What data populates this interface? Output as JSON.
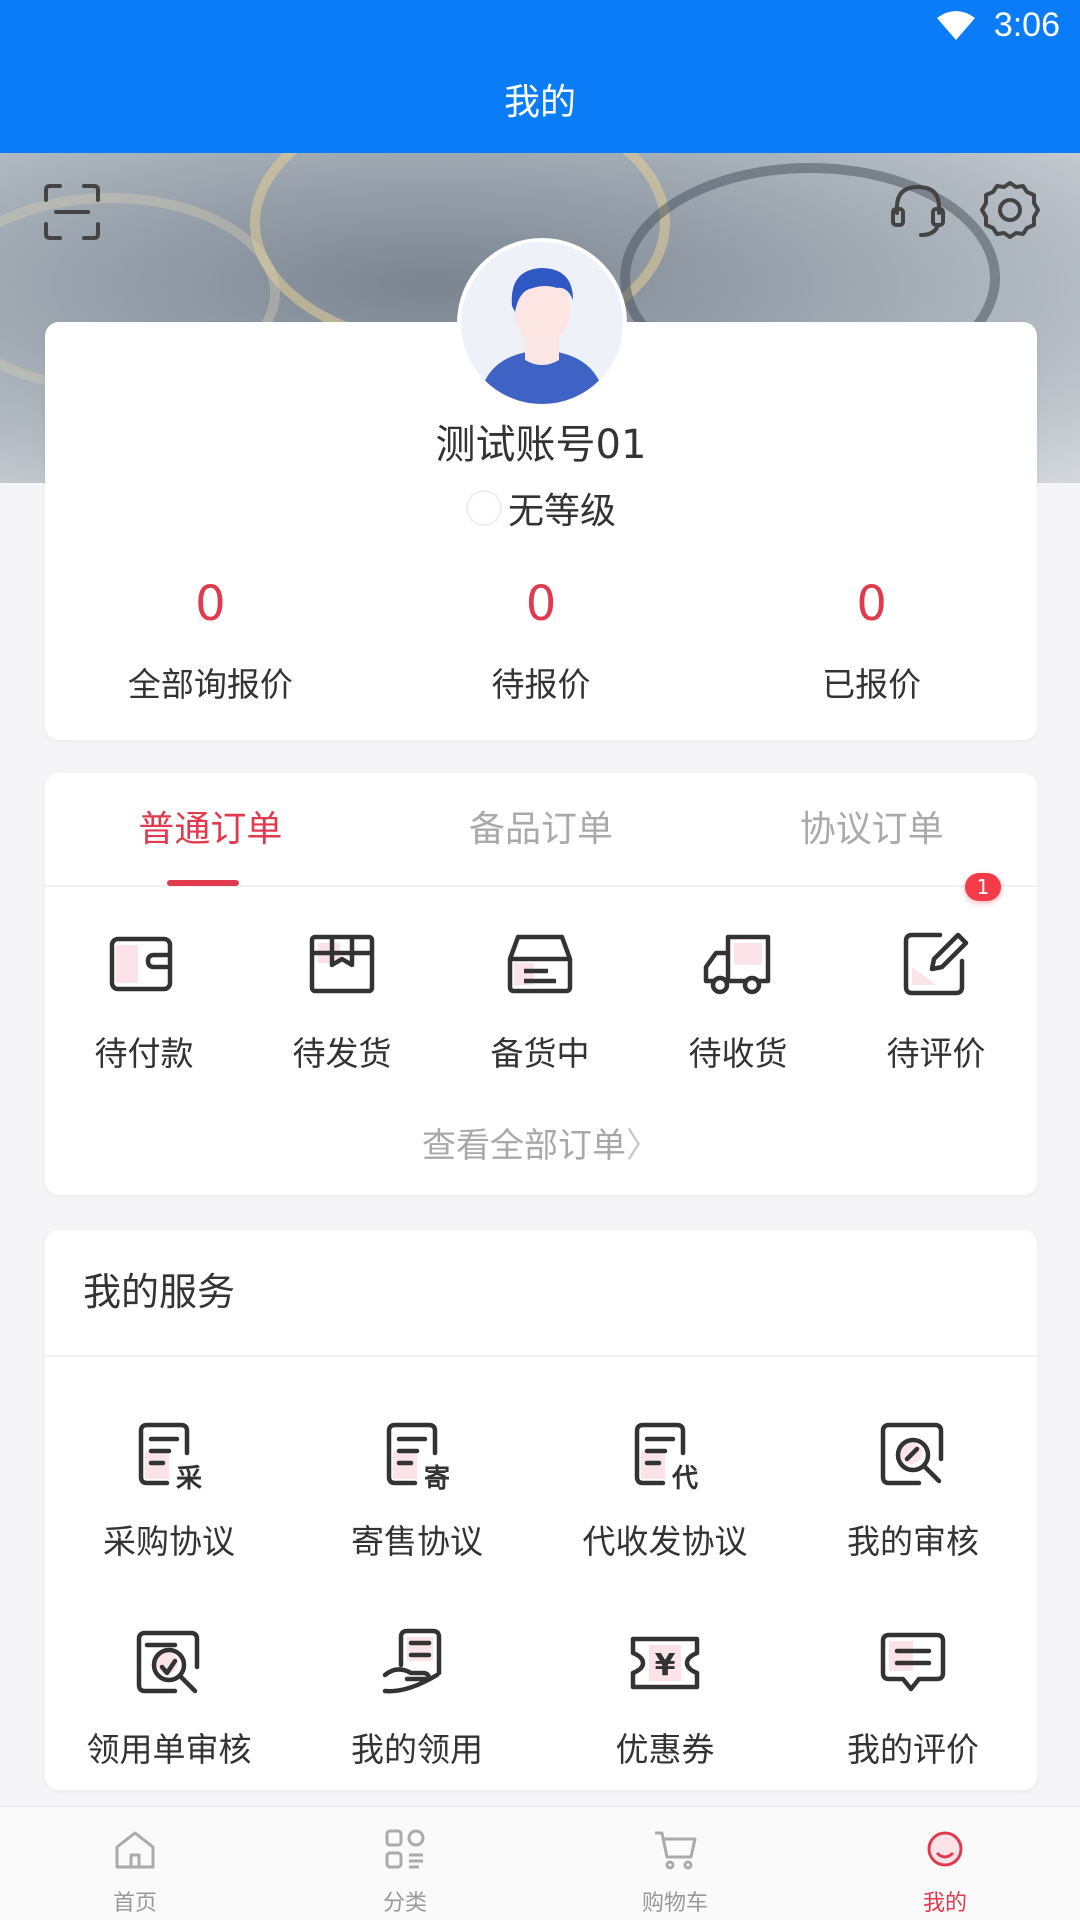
{
  "status_bar": {
    "time": "3:06"
  },
  "header": {
    "title": "我的"
  },
  "profile": {
    "username": "测试账号01",
    "level": "无等级",
    "stats": [
      {
        "value": "0",
        "label": "全部询报价"
      },
      {
        "value": "0",
        "label": "待报价"
      },
      {
        "value": "0",
        "label": "已报价"
      }
    ]
  },
  "orders": {
    "tabs": [
      {
        "label": "普通订单",
        "active": true
      },
      {
        "label": "备品订单",
        "active": false
      },
      {
        "label": "协议订单",
        "active": false
      }
    ],
    "items": [
      {
        "label": "待付款",
        "icon": "wallet-icon"
      },
      {
        "label": "待发货",
        "icon": "package-icon"
      },
      {
        "label": "备货中",
        "icon": "box-icon"
      },
      {
        "label": "待收货",
        "icon": "truck-icon"
      },
      {
        "label": "待评价",
        "icon": "edit-icon",
        "badge": "1"
      }
    ],
    "view_all": "查看全部订单"
  },
  "services": {
    "title": "我的服务",
    "items": [
      {
        "label": "采购协议",
        "icon": "purchase-agreement-icon",
        "tag": "采"
      },
      {
        "label": "寄售协议",
        "icon": "consignment-agreement-icon",
        "tag": "寄"
      },
      {
        "label": "代收发协议",
        "icon": "agency-agreement-icon",
        "tag": "代"
      },
      {
        "label": "我的审核",
        "icon": "review-icon"
      },
      {
        "label": "领用单审核",
        "icon": "requisition-review-icon"
      },
      {
        "label": "我的领用",
        "icon": "requisition-icon"
      },
      {
        "label": "优惠券",
        "icon": "coupon-icon",
        "tag": "¥"
      },
      {
        "label": "我的评价",
        "icon": "comment-icon"
      }
    ]
  },
  "bottom_nav": [
    {
      "label": "首页",
      "icon": "home-icon"
    },
    {
      "label": "分类",
      "icon": "category-icon"
    },
    {
      "label": "购物车",
      "icon": "cart-icon"
    },
    {
      "label": "我的",
      "icon": "profile-icon",
      "active": true
    }
  ],
  "colors": {
    "primary_blue": "#0a7cf7",
    "accent_red": "#e03a4e",
    "icon_fill": "#fbe3e7"
  }
}
